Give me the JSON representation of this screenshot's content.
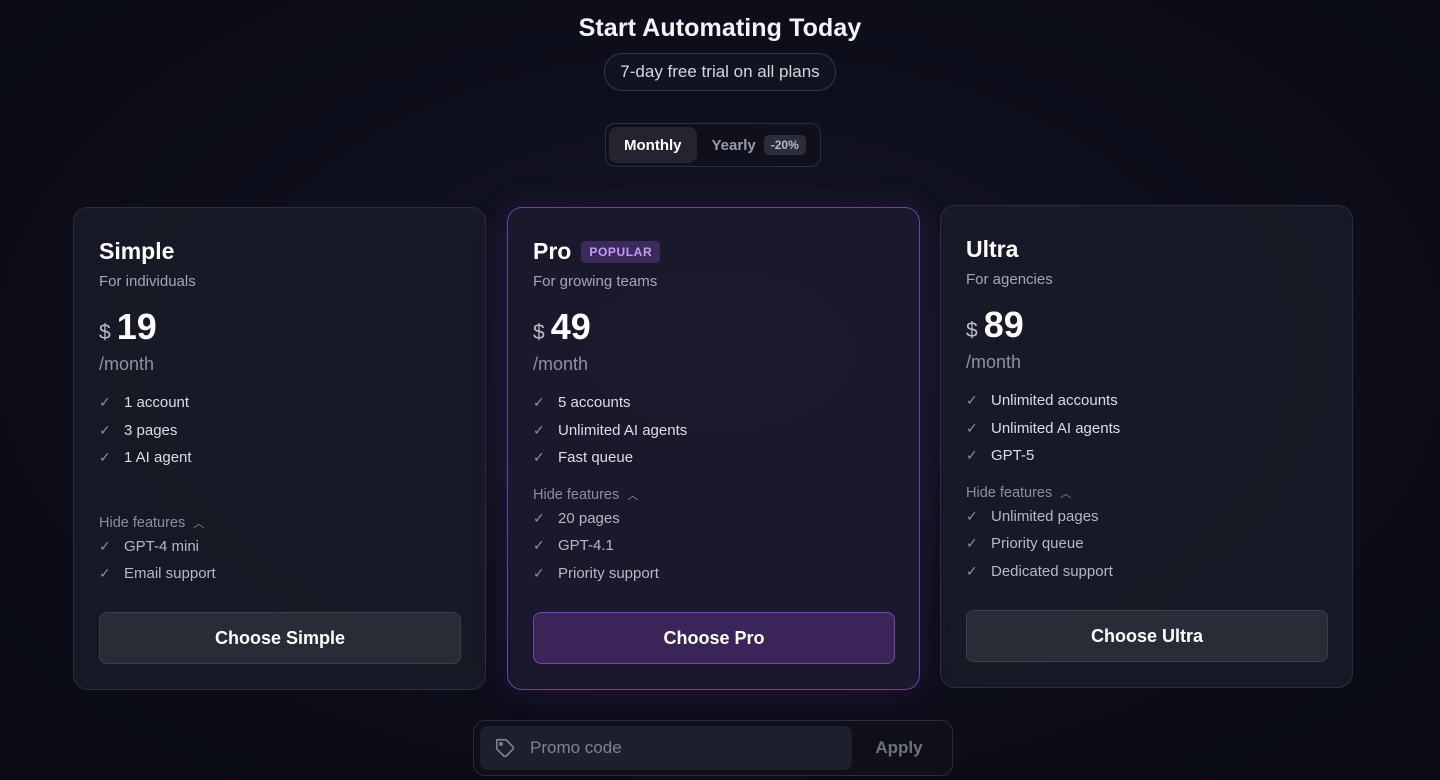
{
  "header": {
    "title": "Start Automating Today",
    "subtitle": "7-day free trial on all plans"
  },
  "billing_toggle": {
    "monthly_label": "Monthly",
    "yearly_label": "Yearly",
    "yearly_discount": "-20%",
    "selected": "Monthly"
  },
  "plans": [
    {
      "name": "Simple",
      "badge": "",
      "description": "For individuals",
      "currency": "$",
      "price": "19",
      "period": "/month",
      "features": [
        "1 account",
        "3 pages",
        "1 AI agent"
      ],
      "hide_label": "Hide features",
      "extra_features": [
        "GPT-4 mini",
        "Email support"
      ],
      "cta": "Choose Simple"
    },
    {
      "name": "Pro",
      "badge": "POPULAR",
      "description": "For growing teams",
      "currency": "$",
      "price": "49",
      "period": "/month",
      "features": [
        "5 accounts",
        "Unlimited AI agents",
        "Fast queue"
      ],
      "hide_label": "Hide features",
      "extra_features": [
        "20 pages",
        "GPT-4.1",
        "Priority support"
      ],
      "cta": "Choose Pro"
    },
    {
      "name": "Ultra",
      "badge": "",
      "description": "For agencies",
      "currency": "$",
      "price": "89",
      "period": "/month",
      "features": [
        "Unlimited accounts",
        "Unlimited AI agents",
        "GPT-5"
      ],
      "hide_label": "Hide features",
      "extra_features": [
        "Unlimited pages",
        "Priority queue",
        "Dedicated support"
      ],
      "cta": "Choose Ultra"
    }
  ],
  "promo": {
    "placeholder": "Promo code",
    "apply_label": "Apply"
  },
  "colors": {
    "accent_purple": "#6c3fb0",
    "badge_text": "#c59af5",
    "background": "#0e0f1c"
  },
  "icons": {
    "check": "check-icon",
    "chevron": "chevron-up-icon",
    "tag": "tag-icon"
  }
}
